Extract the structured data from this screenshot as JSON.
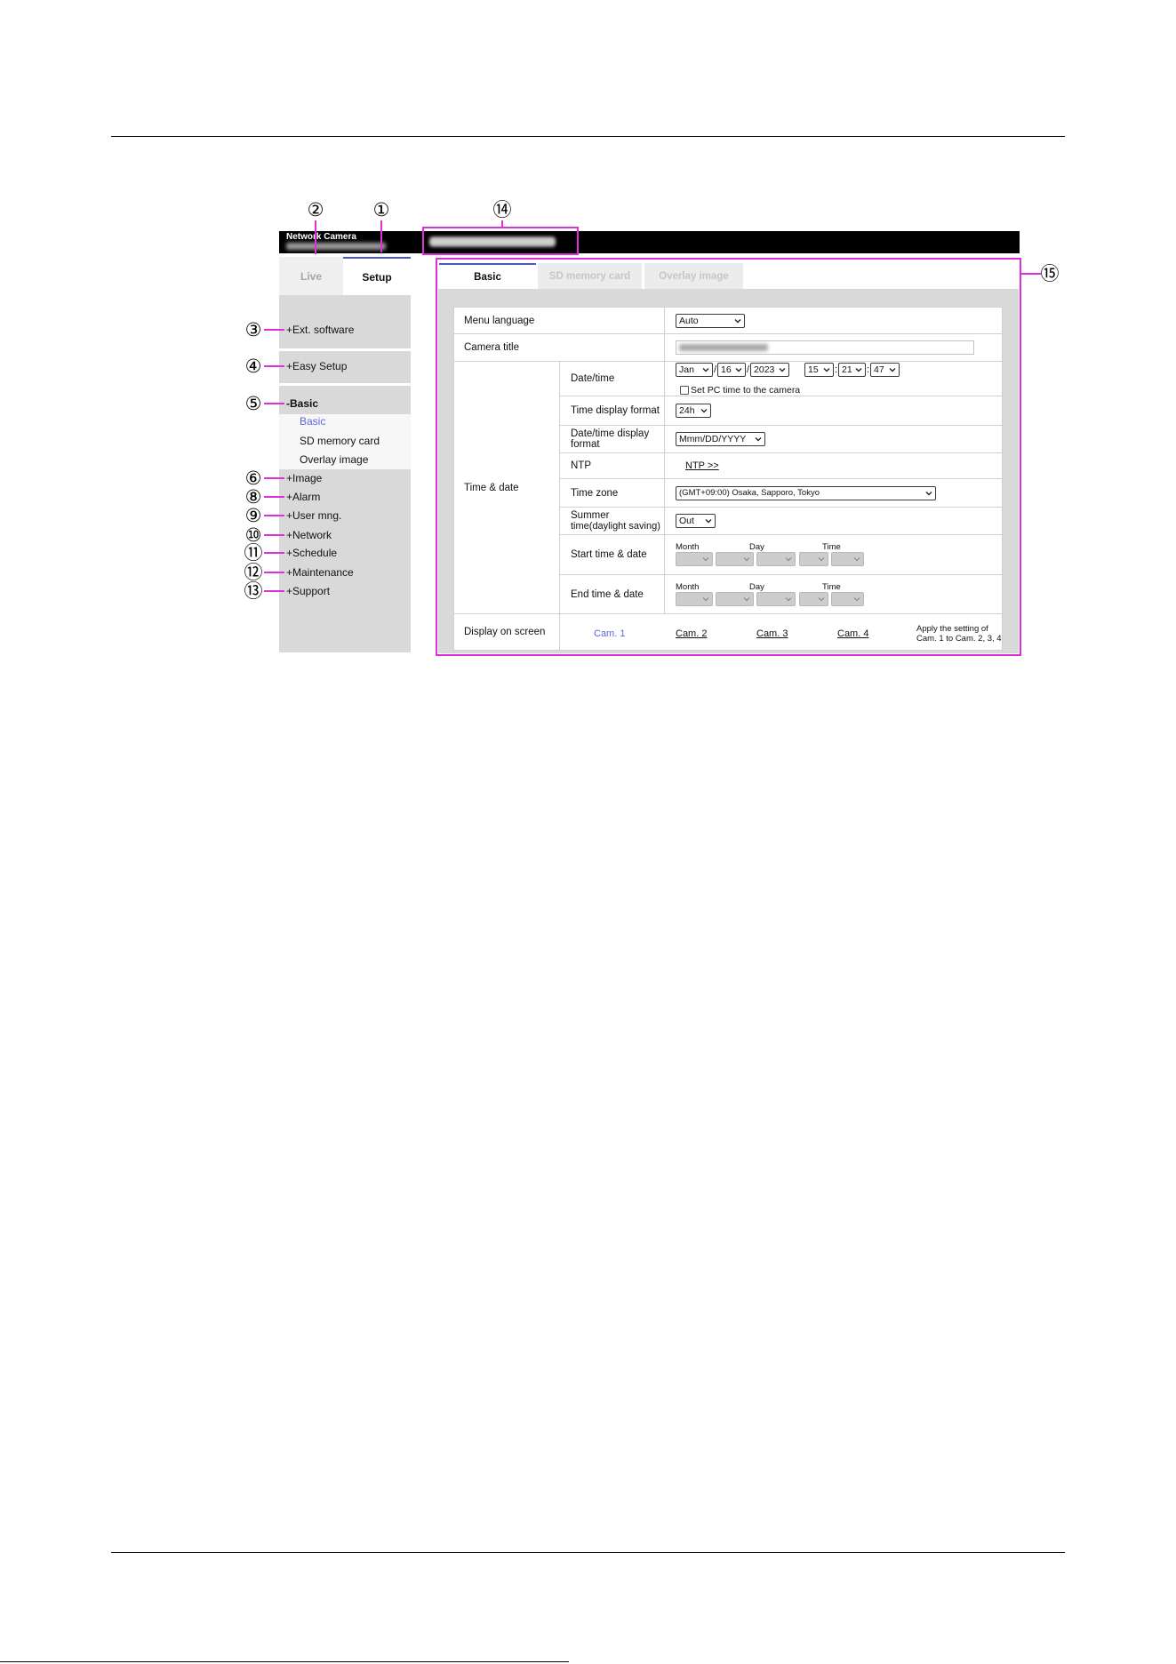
{
  "colors": {
    "callout": "#e12fd8",
    "accent": "#4b55c8",
    "link_active": "#5c66d8"
  },
  "callouts": {
    "c1": "①",
    "c2": "②",
    "c3": "③",
    "c4": "④",
    "c5": "⑤",
    "c6": "⑥",
    "c8": "⑧",
    "c9": "⑨",
    "c10": "⑩",
    "c11": "⑪",
    "c12": "⑫",
    "c13": "⑬",
    "c14": "⑭",
    "c15": "⑮"
  },
  "header": {
    "product_label": "Network Camera"
  },
  "tabs": {
    "live": "Live",
    "setup": "Setup"
  },
  "sidebar": {
    "ext_software": "+Ext. software",
    "easy_setup": "+Easy Setup",
    "basic": "-Basic",
    "basic_items": [
      "Basic",
      "SD memory card",
      "Overlay image"
    ],
    "items": [
      "+Image",
      "+Alarm",
      "+User mng.",
      "+Network",
      "+Schedule",
      "+Maintenance",
      "+Support"
    ]
  },
  "main_tabs": [
    "Basic",
    "SD memory card",
    "Overlay image"
  ],
  "form": {
    "menu_language": {
      "label": "Menu language",
      "value": "Auto"
    },
    "camera_title": {
      "label": "Camera title"
    },
    "time_date": {
      "label": "Time & date",
      "date_time": {
        "label": "Date/time",
        "month": "Jan",
        "day": "16",
        "year": "2023",
        "hour": "15",
        "minute": "21",
        "second": "47",
        "date_sep": "/",
        "time_sep": ":",
        "set_pc_time": "Set PC time to the camera",
        "set_pc_time_checked": false
      },
      "time_display_format": {
        "label": "Time display format",
        "value": "24h"
      },
      "date_display_format": {
        "label_line1": "Date/time display",
        "label_line2": "format",
        "value": "Mmm/DD/YYYY"
      },
      "ntp": {
        "label": "NTP",
        "link": "NTP >>"
      },
      "time_zone": {
        "label": "Time zone",
        "value": "(GMT+09:00) Osaka, Sapporo, Tokyo"
      },
      "summer_time": {
        "label_line1": "Summer",
        "label_line2": "time(daylight saving)",
        "value": "Out"
      },
      "start": {
        "label": "Start time & date",
        "month": "Month",
        "day": "Day",
        "time": "Time"
      },
      "end": {
        "label": "End time & date",
        "month": "Month",
        "day": "Day",
        "time": "Time"
      }
    },
    "display_on_screen": {
      "label": "Display on screen",
      "cams": [
        "Cam. 1",
        "Cam. 2",
        "Cam. 3",
        "Cam. 4"
      ],
      "apply_note_line1": "Apply the setting of",
      "apply_note_line2": "Cam. 1 to Cam. 2, 3, 4"
    }
  }
}
